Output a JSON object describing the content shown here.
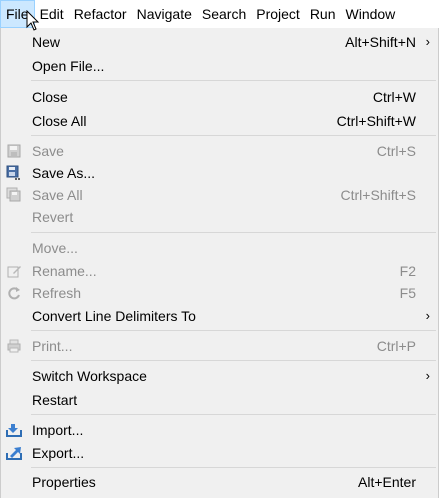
{
  "menubar": {
    "items": [
      {
        "label": "File"
      },
      {
        "label": "Edit"
      },
      {
        "label": "Refactor"
      },
      {
        "label": "Navigate"
      },
      {
        "label": "Search"
      },
      {
        "label": "Project"
      },
      {
        "label": "Run"
      },
      {
        "label": "Window"
      }
    ]
  },
  "file_menu": {
    "new": {
      "label": "New",
      "shortcut": "Alt+Shift+N",
      "arrow": "›"
    },
    "open_file": {
      "label": "Open File..."
    },
    "close": {
      "label": "Close",
      "shortcut": "Ctrl+W"
    },
    "close_all": {
      "label": "Close All",
      "shortcut": "Ctrl+Shift+W"
    },
    "save": {
      "label": "Save",
      "shortcut": "Ctrl+S",
      "icon": "floppy-disk-icon"
    },
    "save_as": {
      "label": "Save As...",
      "icon": "save-as-icon"
    },
    "save_all": {
      "label": "Save All",
      "shortcut": "Ctrl+Shift+S",
      "icon": "save-all-icon"
    },
    "revert": {
      "label": "Revert"
    },
    "move": {
      "label": "Move..."
    },
    "rename": {
      "label": "Rename...",
      "shortcut": "F2",
      "icon": "rename-icon"
    },
    "refresh": {
      "label": "Refresh",
      "shortcut": "F5",
      "icon": "refresh-icon"
    },
    "convert_line_delimiters": {
      "label": "Convert Line Delimiters To",
      "arrow": "›"
    },
    "print": {
      "label": "Print...",
      "shortcut": "Ctrl+P",
      "icon": "printer-icon"
    },
    "switch_workspace": {
      "label": "Switch Workspace",
      "arrow": "›"
    },
    "restart": {
      "label": "Restart"
    },
    "import": {
      "label": "Import...",
      "icon": "import-icon"
    },
    "export": {
      "label": "Export...",
      "icon": "export-icon"
    },
    "properties": {
      "label": "Properties",
      "shortcut": "Alt+Enter"
    }
  },
  "colors": {
    "menu_background": "#f0f0f0",
    "active_menubar_item": "#cce8ff",
    "disabled_text": "#8c8c8c",
    "separator": "#d7d7d7"
  }
}
